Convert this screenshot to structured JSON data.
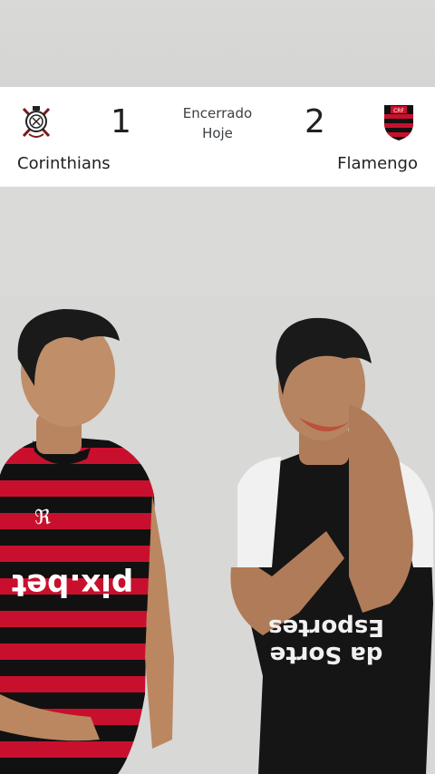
{
  "match": {
    "home": {
      "name": "Corinthians",
      "score": "1",
      "crest": "corinthians-crest-icon"
    },
    "away": {
      "name": "Flamengo",
      "score": "2",
      "crest": "flamengo-crest-icon"
    },
    "status": "Encerrado",
    "date": "Hoje"
  },
  "jerseys": {
    "left": "pix.bet",
    "right_line1": "Esportes",
    "right_line2": "da Sorte"
  },
  "colors": {
    "flamengo_red": "#c8102e",
    "flamengo_black": "#111111",
    "corinthians_black": "#222222",
    "card_bg": "#ffffff",
    "text": "#202124"
  }
}
